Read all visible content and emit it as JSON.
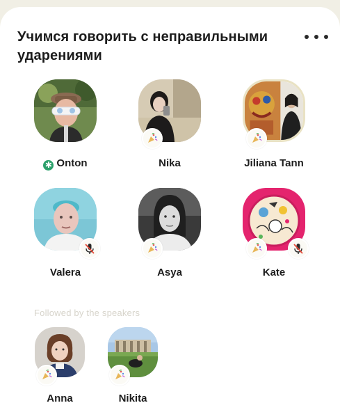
{
  "room": {
    "title": "Учимся говорить с неправильными ударениями",
    "more_icon": "more-dots-icon"
  },
  "speakers": [
    {
      "name": "Onton",
      "moderator": true,
      "badge": "none"
    },
    {
      "name": "Nika",
      "badge": "party-popper-icon"
    },
    {
      "name": "Jiliana Tann",
      "badge": "party-popper-icon"
    },
    {
      "name": "Valera",
      "badge": "mic-muted-icon"
    },
    {
      "name": "Asya",
      "badge": "party-popper-icon"
    },
    {
      "name": "Kate",
      "badge": "party-popper-icon",
      "muted": true
    }
  ],
  "followed_section": {
    "label": "Followed by the speakers",
    "people": [
      {
        "name": "Anna",
        "badge": "party-popper-icon"
      },
      {
        "name": "Nikita",
        "badge": "party-popper-icon"
      }
    ]
  },
  "colors": {
    "moderator_green": "#2ba06a",
    "background": "#f1efe5",
    "card": "#ffffff",
    "muted_label": "#d7d4cb"
  }
}
